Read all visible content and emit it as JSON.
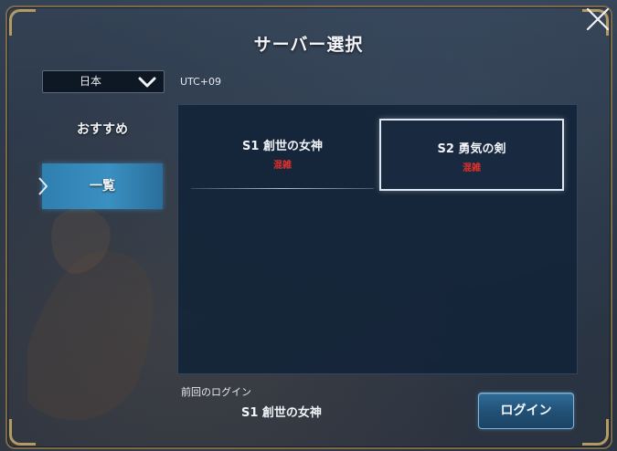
{
  "dialog": {
    "title": "サーバー選択"
  },
  "region": {
    "selected": "日本",
    "timezone": "UTC+09"
  },
  "tabs": [
    {
      "label": "おすすめ",
      "active": false
    },
    {
      "label": "一覧",
      "active": true
    }
  ],
  "servers": [
    {
      "name": "S1 創世の女神",
      "status": "混雑",
      "selected": false
    },
    {
      "name": "S2 勇気の剣",
      "status": "混雑",
      "selected": true
    }
  ],
  "last_login": {
    "label": "前回のログイン",
    "server": "S1 創世の女神"
  },
  "login_button": {
    "label": "ログイン"
  },
  "colors": {
    "status_busy": "#e0312c",
    "accent_tab": "#3a90c2",
    "frame_gold": "#b49a63"
  },
  "icons": {
    "close": "close-icon",
    "dropdown": "chevron-down-icon",
    "tab_pointer": "chevron-right-icon"
  }
}
